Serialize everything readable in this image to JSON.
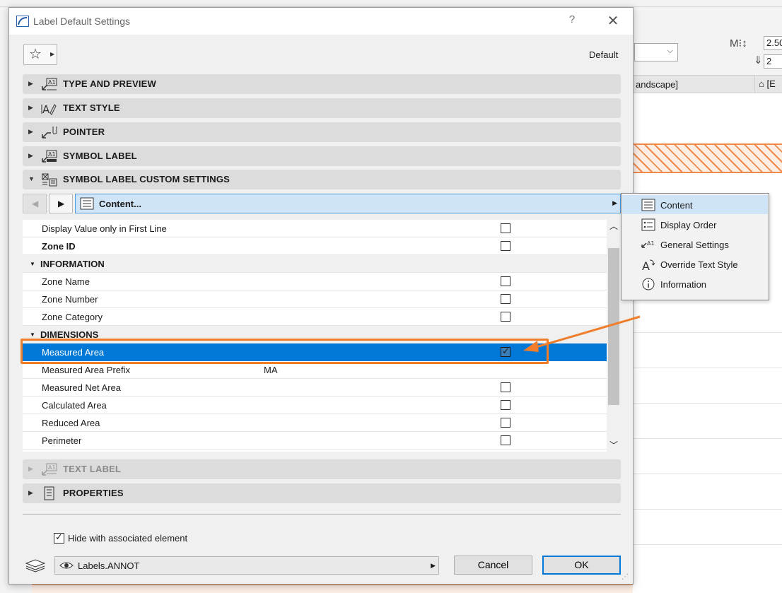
{
  "dialog": {
    "title": "Label Default Settings",
    "help_label": "?",
    "close_label": "✕",
    "default_label": "Default"
  },
  "sections": {
    "type_preview": "TYPE AND PREVIEW",
    "text_style": "TEXT STYLE",
    "pointer": "POINTER",
    "symbol_label": "SYMBOL LABEL",
    "custom_settings": "SYMBOL LABEL CUSTOM SETTINGS",
    "text_label": "TEXT LABEL",
    "properties": "PROPERTIES"
  },
  "page_selector": {
    "label": "Content..."
  },
  "list": {
    "rows": [
      {
        "label": "Display Value only in First Line",
        "checked": false
      },
      {
        "label": "Zone ID",
        "checked": false
      },
      {
        "label": "INFORMATION"
      },
      {
        "label": "Zone Name",
        "checked": false
      },
      {
        "label": "Zone Number",
        "checked": false
      },
      {
        "label": "Zone Category",
        "checked": false
      },
      {
        "label": "DIMENSIONS"
      },
      {
        "label": "Measured Area",
        "checked": true
      },
      {
        "label": "Measured Area Prefix",
        "value": "MA"
      },
      {
        "label": "Measured Net Area",
        "checked": false
      },
      {
        "label": "Calculated Area",
        "checked": false
      },
      {
        "label": "Reduced Area",
        "checked": false
      },
      {
        "label": "Perimeter",
        "checked": false
      }
    ]
  },
  "footer": {
    "hide_label": "Hide with associated element",
    "layer_value": "Labels.ANNOT",
    "cancel_label": "Cancel",
    "ok_label": "OK"
  },
  "popup_menu": {
    "items": [
      {
        "label": "Content"
      },
      {
        "label": "Display Order"
      },
      {
        "label": "General Settings"
      },
      {
        "label": "Override Text Style"
      },
      {
        "label": "Information"
      }
    ]
  },
  "background": {
    "field_a": "2.50",
    "field_b": "2",
    "tab_a": "andscape]",
    "tab_b": "[E"
  },
  "colors": {
    "accent": "#0078d7",
    "highlight": "#f07d29",
    "selection_bg": "#cfe4f7"
  }
}
